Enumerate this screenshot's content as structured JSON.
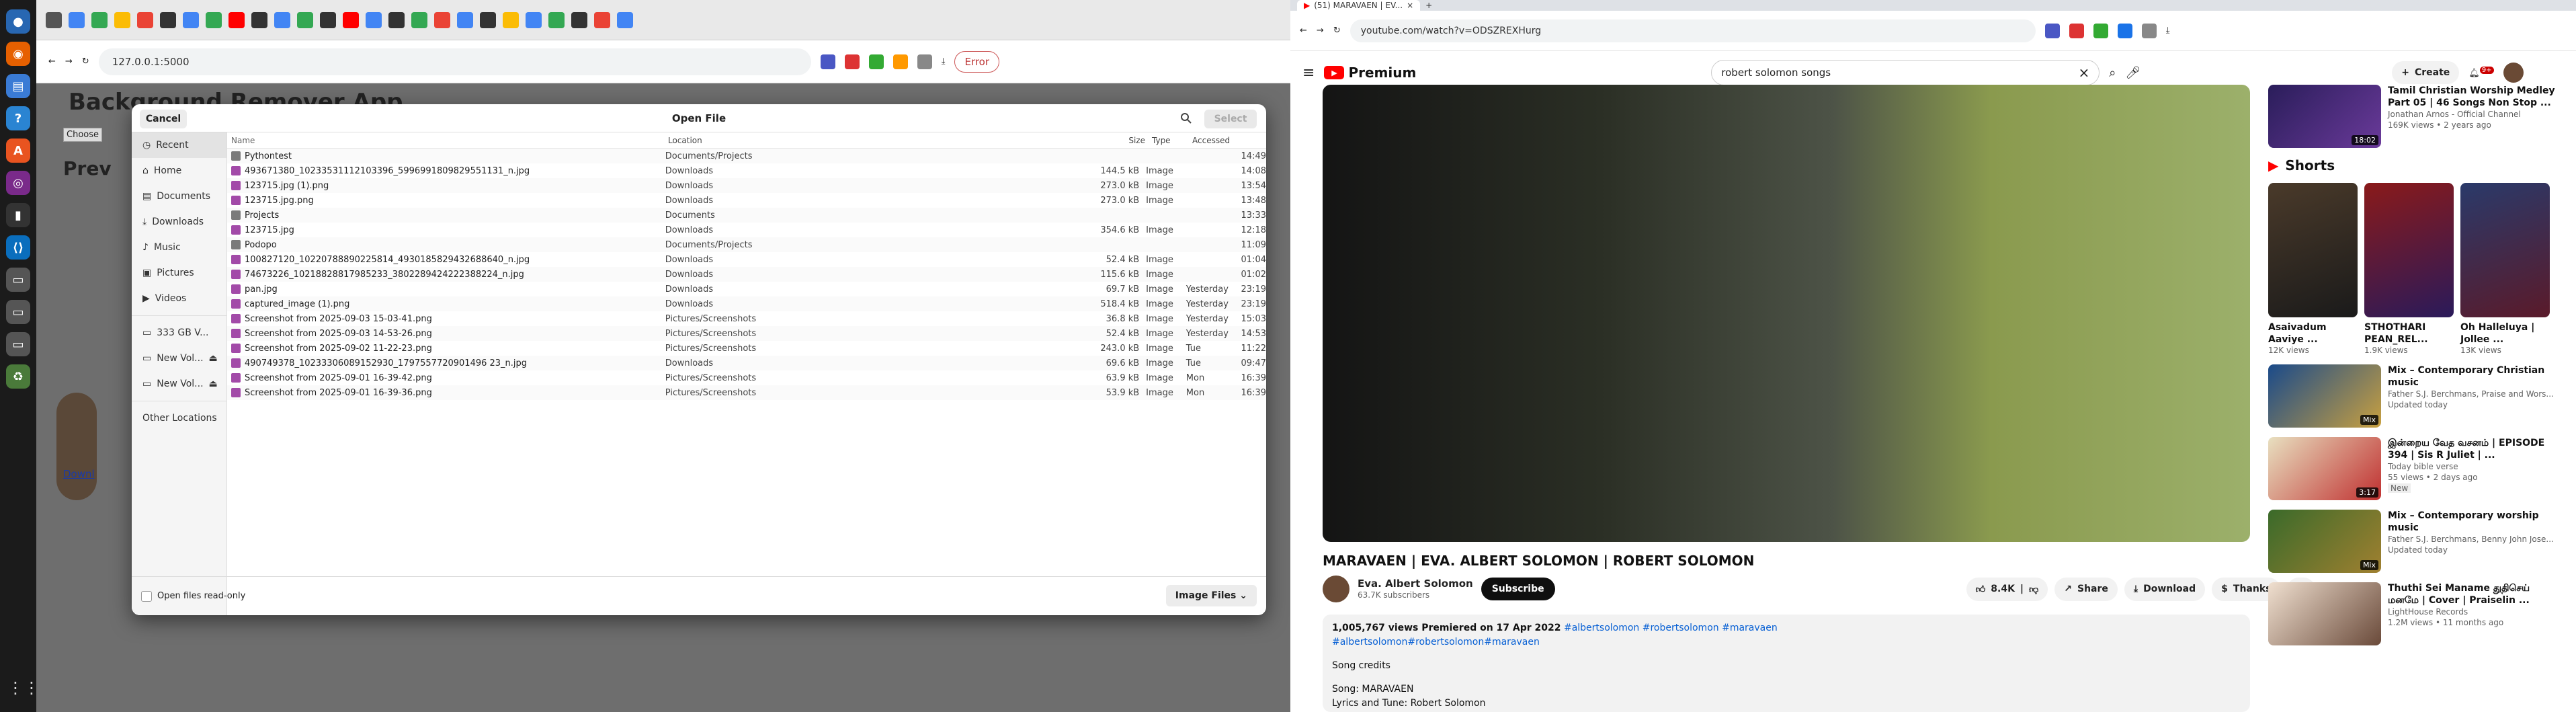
{
  "left_browser": {
    "url": "127.0.0.1:5000",
    "error_label": "Error",
    "page": {
      "title": "Background Remover App",
      "choose_label": "Choose",
      "preview_heading": "Prev",
      "download_link": "Downl"
    }
  },
  "dialog": {
    "title": "Open File",
    "cancel": "Cancel",
    "select": "Select",
    "sidebar": [
      "Recent",
      "Home",
      "Documents",
      "Downloads",
      "Music",
      "Pictures",
      "Videos"
    ],
    "volumes": [
      "333 GB V...",
      "New Vol...",
      "New Vol..."
    ],
    "other": "Other Locations",
    "columns": {
      "name": "Name",
      "location": "Location",
      "size": "Size",
      "type": "Type",
      "accessed": "Accessed"
    },
    "rows": [
      {
        "n": "Pythontest",
        "l": "Documents/Projects",
        "s": "",
        "t": "",
        "a": "",
        "tm": "14:49",
        "k": "fold"
      },
      {
        "n": "493671380_10233531112103396_5996991809829551131_n.jpg",
        "l": "Downloads",
        "s": "144.5 kB",
        "t": "Image",
        "a": "",
        "tm": "14:08",
        "k": "img"
      },
      {
        "n": "123715.jpg (1).png",
        "l": "Downloads",
        "s": "273.0 kB",
        "t": "Image",
        "a": "",
        "tm": "13:54",
        "k": "img"
      },
      {
        "n": "123715.jpg.png",
        "l": "Downloads",
        "s": "273.0 kB",
        "t": "Image",
        "a": "",
        "tm": "13:48",
        "k": "img"
      },
      {
        "n": "Projects",
        "l": "Documents",
        "s": "",
        "t": "",
        "a": "",
        "tm": "13:33",
        "k": "fold"
      },
      {
        "n": "123715.jpg",
        "l": "Downloads",
        "s": "354.6 kB",
        "t": "Image",
        "a": "",
        "tm": "12:18",
        "k": "img"
      },
      {
        "n": "Podopo",
        "l": "Documents/Projects",
        "s": "",
        "t": "",
        "a": "",
        "tm": "11:09",
        "k": "fold"
      },
      {
        "n": "100827120_10220788890225814_4930185829432688640_n.jpg",
        "l": "Downloads",
        "s": "52.4 kB",
        "t": "Image",
        "a": "",
        "tm": "01:04",
        "k": "img"
      },
      {
        "n": "74673226_10218828817985233_3802289424222388224_n.jpg",
        "l": "Downloads",
        "s": "115.6 kB",
        "t": "Image",
        "a": "",
        "tm": "01:02",
        "k": "img"
      },
      {
        "n": "pan.jpg",
        "l": "Downloads",
        "s": "69.7 kB",
        "t": "Image",
        "a": "Yesterday",
        "tm": "23:19",
        "k": "img"
      },
      {
        "n": "captured_image (1).png",
        "l": "Downloads",
        "s": "518.4 kB",
        "t": "Image",
        "a": "Yesterday",
        "tm": "23:19",
        "k": "img"
      },
      {
        "n": "Screenshot from 2025-09-03 15-03-41.png",
        "l": "Pictures/Screenshots",
        "s": "36.8 kB",
        "t": "Image",
        "a": "Yesterday",
        "tm": "15:03",
        "k": "img"
      },
      {
        "n": "Screenshot from 2025-09-03 14-53-26.png",
        "l": "Pictures/Screenshots",
        "s": "52.4 kB",
        "t": "Image",
        "a": "Yesterday",
        "tm": "14:53",
        "k": "img"
      },
      {
        "n": "Screenshot from 2025-09-02 11-22-23.png",
        "l": "Pictures/Screenshots",
        "s": "243.0 kB",
        "t": "Image",
        "a": "Tue",
        "tm": "11:22",
        "k": "img"
      },
      {
        "n": "490749378_10233306089152930_1797557720901496 23_n.jpg",
        "l": "Downloads",
        "s": "69.6 kB",
        "t": "Image",
        "a": "Tue",
        "tm": "09:47",
        "k": "img"
      },
      {
        "n": "Screenshot from 2025-09-01 16-39-42.png",
        "l": "Pictures/Screenshots",
        "s": "63.9 kB",
        "t": "Image",
        "a": "Mon",
        "tm": "16:39",
        "k": "img"
      },
      {
        "n": "Screenshot from 2025-09-01 16-39-36.png",
        "l": "Pictures/Screenshots",
        "s": "53.9 kB",
        "t": "Image",
        "a": "Mon",
        "tm": "16:39",
        "k": "img"
      }
    ],
    "readonly_label": "Open files read-only",
    "filter_label": "Image Files"
  },
  "youtube": {
    "tab_title": "(51) MARAVAEN | EV...",
    "url": "youtube.com/watch?v=ODSZREXHurg",
    "brand": "Premium",
    "search_value": "robert solomon songs",
    "create_label": "Create",
    "notif_count": "9+",
    "video_title": "MARAVAEN | EVA. ALBERT SOLOMON | ROBERT SOLOMON",
    "channel": "Eva. Albert Solomon",
    "subscribers": "63.7K subscribers",
    "subscribe": "Subscribe",
    "likes": "8.4K",
    "share": "Share",
    "download": "Download",
    "thanks": "Thanks",
    "meta": "1,005,767 views  Premiered on 17 Apr 2022",
    "tags1": "#albertsolomon #robertsolomon #maravaen",
    "tags2": "#albertsolomon#robertsolomon#maravaen",
    "credits": "Song credits",
    "song": "Song: MARAVAEN",
    "lyrics": "Lyrics and Tune: Robert Solomon",
    "top_sug": {
      "title": "Tamil Christian Worship Medley Part 05 | 46 Songs Non Stop ...",
      "channel": "Jonathan Arnos - Official Channel",
      "meta": "169K views • 2 years ago",
      "dur": "18:02"
    },
    "shorts_heading": "Shorts",
    "shorts": [
      {
        "title": "Asaivadum Aaviye ...",
        "views": "12K views"
      },
      {
        "title": "STHOTHARI PEAN_REL...",
        "views": "1.9K views"
      },
      {
        "title": "Oh Halleluya | Jollee ...",
        "views": "13K views"
      }
    ],
    "suggestions": [
      {
        "title": "Mix – Contemporary Christian music",
        "channel": "Father S.J. Berchmans, Praise and Wors...",
        "meta": "Updated today",
        "dur": "Mix"
      },
      {
        "title": "இன்றைய வேத வசனம் | EPISODE 394 | Sis R Juliet | ...",
        "channel": "Today bible verse",
        "meta": "55 views • 2 days ago",
        "dur": "3:17",
        "badge": "New"
      },
      {
        "title": "Mix – Contemporary worship music",
        "channel": "Father S.J. Berchmans, Benny John Jose...",
        "meta": "Updated today",
        "dur": "Mix"
      },
      {
        "title": "Thuthi Sei Maname துதிசெய் மனமே | Cover | Praiselin ...",
        "channel": "LightHouse Records",
        "meta": "1.2M views • 11 months ago",
        "dur": ""
      }
    ]
  },
  "colors": {
    "dialog_select": "#e9e9e9",
    "yt_red": "#ff0000",
    "link_blue": "#065fd4"
  }
}
